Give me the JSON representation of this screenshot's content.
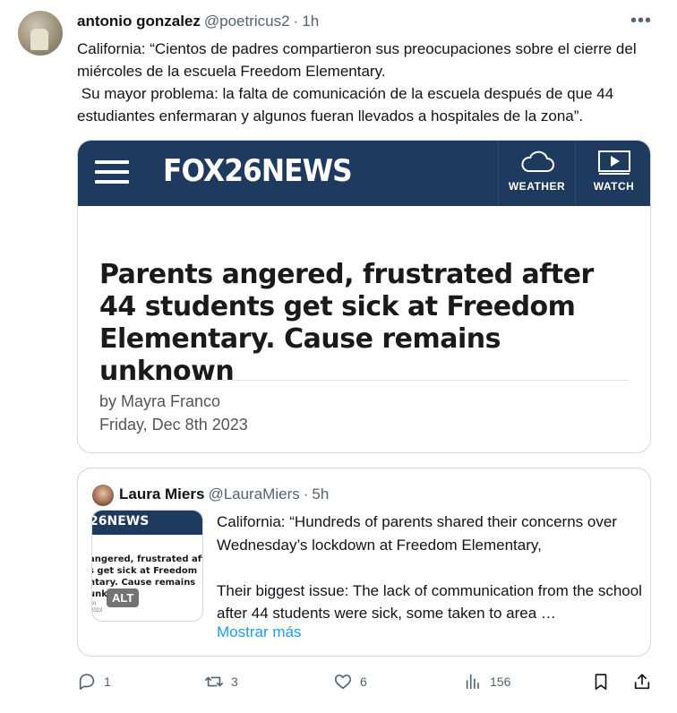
{
  "tweet": {
    "author_name": "antonio gonzalez",
    "author_handle": "@poetricus2",
    "separator": "·",
    "time": "1h",
    "text": "California: “Cientos de padres compartieron sus preocupaciones sobre el cierre del miércoles de la escuela Freedom Elementary.\n Su mayor problema: la falta de comunicación de la escuela después de que 44 estudiantes enfermaran y algunos fueran llevados a hospitales de la zona”."
  },
  "card": {
    "logo": "FOX26NEWS",
    "weather_label": "WEATHER",
    "watch_label": "WATCH",
    "title": "Parents angered, frustrated after 44 students get sick at Freedom Elementary. Cause remains unknown",
    "byline": "by Mayra Franco",
    "date": "Friday, Dec 8th 2023"
  },
  "quote": {
    "author_name": "Laura Miers",
    "author_handle": "@LauraMiers",
    "separator": "·",
    "time": "5h",
    "thumb_logo": "26NEWS",
    "thumb_title": "angered, frustrated aft\ns get sick at Freedom\nntary. Cause remains unk",
    "thumb_small": "co\n2023",
    "alt_label": "ALT",
    "text": "California: “Hundreds of parents shared their concerns over Wednesday’s lockdown at Freedom Elementary,\n\nTheir biggest issue: The lack of communication from the school after 44 students were sick, some taken to area …",
    "show_more": "Mostrar más"
  },
  "actions": {
    "replies": "1",
    "retweets": "3",
    "likes": "6",
    "views": "156"
  },
  "colors": {
    "fox_navy": "#1f3a5f",
    "link_blue": "#1d9bf0",
    "muted": "#536471"
  },
  "icons": [
    "more-icon",
    "hamburger-icon",
    "cloud-icon",
    "play-icon",
    "reply-icon",
    "retweet-icon",
    "like-icon",
    "views-icon",
    "bookmark-icon",
    "share-icon"
  ]
}
